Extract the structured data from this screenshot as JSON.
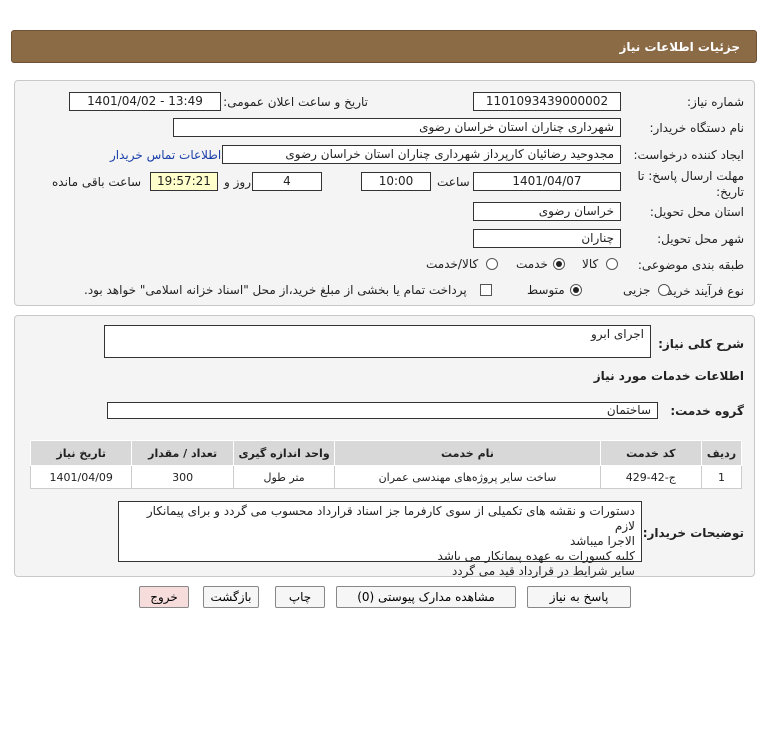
{
  "header": {
    "title": "جزئیات اطلاعات نیاز"
  },
  "form": {
    "need_number_label": "شماره نیاز:",
    "need_number": "1101093439000002",
    "announce_label": "تاریخ و ساعت اعلان عمومی:",
    "announce_value": "1401/04/02 - 13:49",
    "buyer_org_label": "نام دستگاه خریدار:",
    "buyer_org": "شهرداری چناران استان خراسان رضوی",
    "creator_label": "ایجاد کننده درخواست:",
    "creator": "مجدوحید رضائیان کارپرداز شهرداری چناران استان خراسان رضوی",
    "contact_link": "اطلاعات تماس خریدار",
    "deadline_label": "مهلت ارسال پاسخ: تا تاریخ:",
    "deadline_date": "1401/04/07",
    "time_label": "ساعت",
    "deadline_time": "10:00",
    "days_value": "4",
    "days_label": "روز و",
    "remaining_time": "19:57:21",
    "remaining_label": "ساعت باقی مانده",
    "province_label": "استان محل تحویل:",
    "province": "خراسان رضوی",
    "city_label": "شهر محل تحویل:",
    "city": "چناران",
    "category_label": "طبقه بندی موضوعی:",
    "category_options": [
      "کالا",
      "خدمت",
      "کالا/خدمت"
    ],
    "process_label": "نوع فرآیند خرید :",
    "process_options": [
      "جزیی",
      "متوسط"
    ],
    "payment_note": "پرداخت تمام یا بخشی از مبلغ خرید،از محل \"اسناد خزانه اسلامی\" خواهد بود."
  },
  "summary": {
    "desc_label": "شرح کلی نیاز:",
    "desc": "اجرای ابرو",
    "services_title": "اطلاعات خدمات مورد نیاز",
    "group_label": "گروه خدمت:",
    "group": "ساختمان",
    "table": {
      "headers": [
        "ردیف",
        "کد خدمت",
        "نام خدمت",
        "واحد اندازه گیری",
        "تعداد / مقدار",
        "تاریخ نیاز"
      ],
      "rows": [
        [
          "1",
          "ج-42-429",
          "ساخت سایر پروژه‌های مهندسی عمران",
          "متر طول",
          "300",
          "1401/04/09"
        ]
      ]
    },
    "notes_label": "توضیحات خریدار:",
    "notes": [
      "دستورات و نقشه های تکمیلی از سوی کارفرما جز اسناد قرارداد محسوب می گردد و برای پیمانکار لازم",
      "الاجرا میباشد",
      "کلیه کسورات به عهده پیمانکار می باشد",
      "سایر شرایط در قرارداد قید می گردد"
    ]
  },
  "buttons": {
    "reply": "پاسخ به نیاز",
    "attachments": "مشاهده مدارک پیوستی (0)",
    "print": "چاپ",
    "back": "بازگشت",
    "exit": "خروج"
  }
}
